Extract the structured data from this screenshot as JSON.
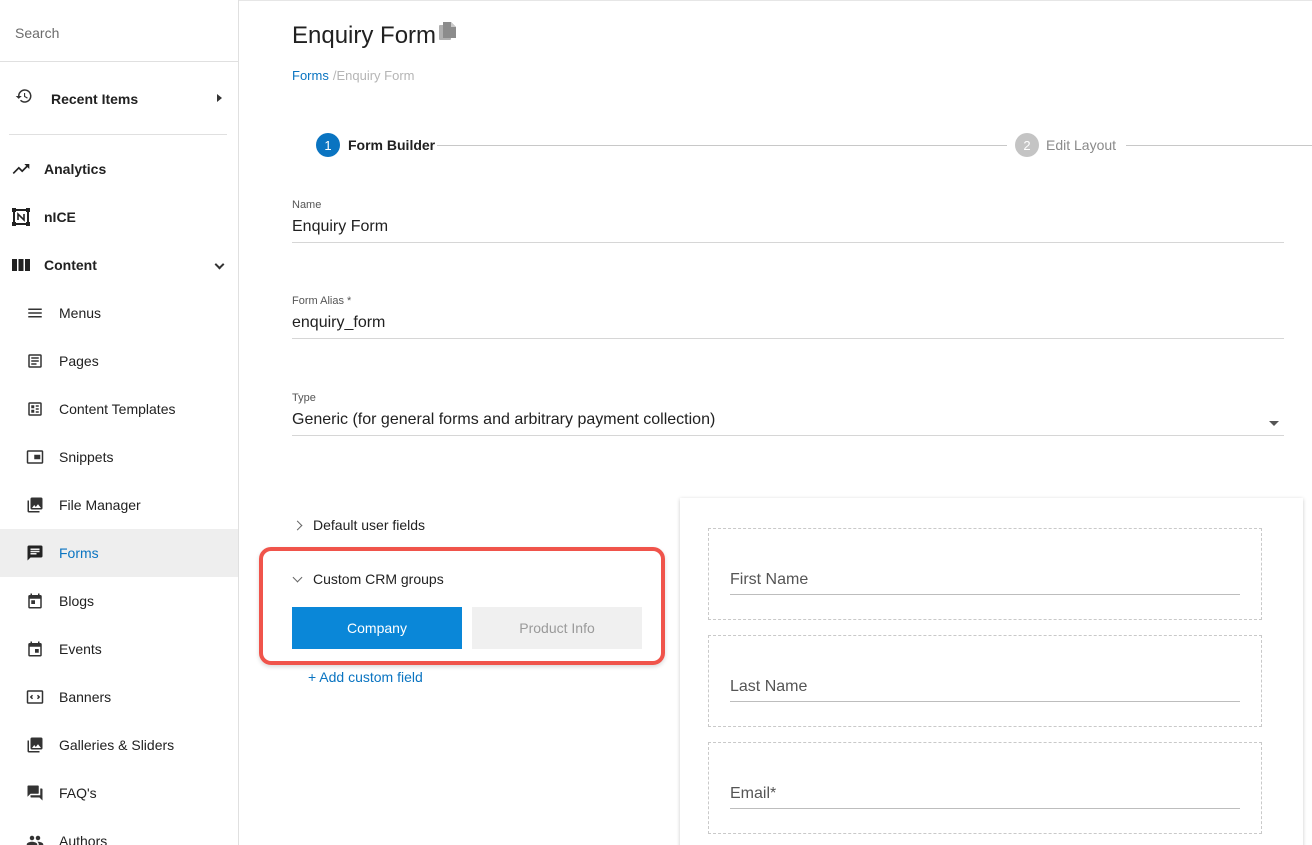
{
  "sidebar": {
    "search_placeholder": "Search",
    "recent_items": "Recent Items",
    "items": [
      {
        "label": "Analytics",
        "icon": "trending-up-icon"
      },
      {
        "label": "nICE",
        "icon": "nice-icon"
      },
      {
        "label": "Content",
        "icon": "columns-icon"
      }
    ],
    "content_items": [
      {
        "label": "Menus",
        "icon": "menu-icon"
      },
      {
        "label": "Pages",
        "icon": "page-icon"
      },
      {
        "label": "Content Templates",
        "icon": "template-icon"
      },
      {
        "label": "Snippets",
        "icon": "snippet-icon"
      },
      {
        "label": "File Manager",
        "icon": "file-manager-icon"
      },
      {
        "label": "Forms",
        "icon": "forms-icon",
        "active": true
      },
      {
        "label": "Blogs",
        "icon": "blog-icon"
      },
      {
        "label": "Events",
        "icon": "event-icon"
      },
      {
        "label": "Banners",
        "icon": "banner-icon"
      },
      {
        "label": "Galleries & Sliders",
        "icon": "gallery-icon"
      },
      {
        "label": "FAQ's",
        "icon": "faq-icon"
      },
      {
        "label": "Authors",
        "icon": "authors-icon"
      }
    ]
  },
  "header": {
    "title": "Enquiry Form",
    "breadcrumb_root": "Forms",
    "breadcrumb_sep": "/",
    "breadcrumb_current": "Enquiry Form"
  },
  "stepper": {
    "step1_num": "1",
    "step1_label": "Form Builder",
    "step2_num": "2",
    "step2_label": "Edit Layout"
  },
  "form": {
    "name_label": "Name",
    "name_value": "Enquiry Form",
    "alias_label": "Form Alias *",
    "alias_value": "enquiry_form",
    "type_label": "Type",
    "type_value": "Generic (for general forms and arbitrary payment collection)"
  },
  "groups": {
    "default_fields": "Default user fields",
    "custom_crm": "Custom CRM groups",
    "tab_company": "Company",
    "tab_product": "Product Info",
    "add_custom_field": "+ Add custom field"
  },
  "preview": {
    "fields": [
      "First Name",
      "Last Name",
      "Email*"
    ]
  },
  "colors": {
    "accent": "#0a74c1",
    "highlight": "#f0544b"
  }
}
